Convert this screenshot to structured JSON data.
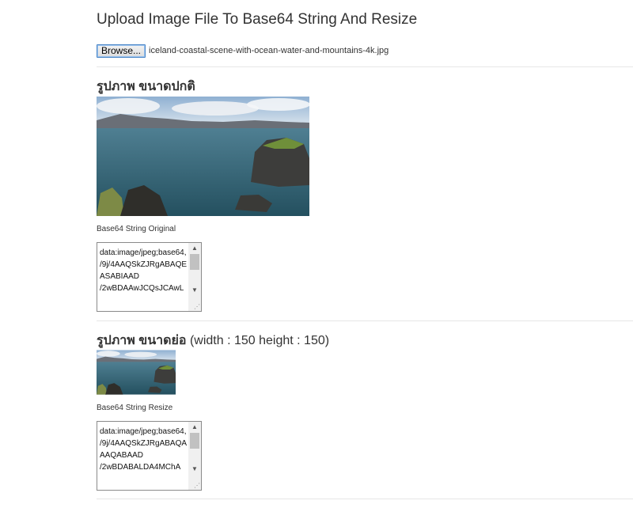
{
  "header": {
    "title": "Upload Image File To Base64 String And Resize"
  },
  "upload": {
    "browse_label": "Browse...",
    "file_name": "iceland-coastal-scene-with-ocean-water-and-mountains-4k.jpg"
  },
  "original": {
    "heading_thai": "รูปภาพ ขนาดปกติ",
    "image_alt": "iceland coastal scene",
    "caption": "Base64 String Original",
    "base64_value": "data:image/jpeg;base64,\n/9j/4AAQSkZJRgABAQEASABIAAD\n/2wBDAAwJCQsJCAwL"
  },
  "resized": {
    "heading_thai": "รูปภาพ ขนาดย่อ",
    "heading_dims": " (width : 150 height : 150)",
    "image_alt": "iceland coastal scene resized",
    "caption": "Base64 String Resize",
    "base64_value": "data:image/jpeg;base64,\n/9j/4AAQSkZJRgABAQAAAQABAAD\n/2wBDABALDA4MChA"
  }
}
